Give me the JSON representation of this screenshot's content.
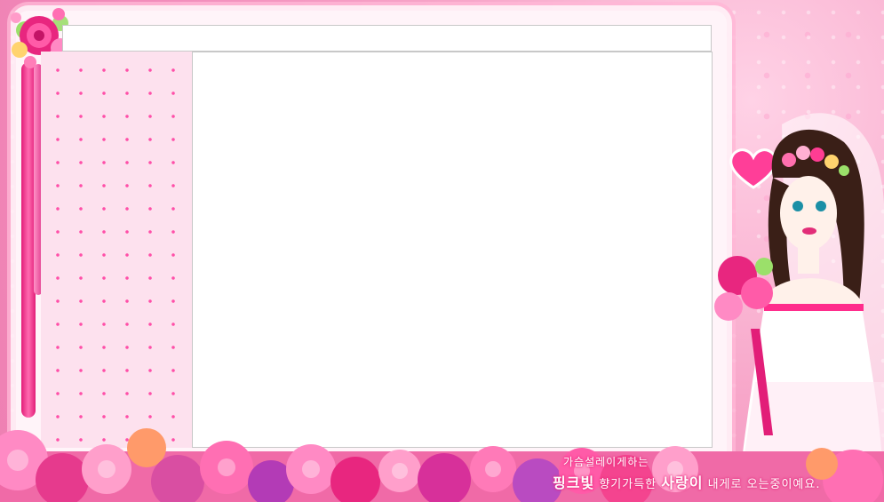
{
  "theme": {
    "accent": "#e21e78",
    "panel_background": "#fde1ee",
    "content_background": "#ffffff",
    "frame_border": "#c8c8c8"
  },
  "top_bar": {
    "text": ""
  },
  "main_content": {
    "text": ""
  },
  "decorations": {
    "corner_icon": "rose-bouquet-icon",
    "heart_icon": "heart-icon",
    "bride_illustration": "bride-illustration",
    "bottom_border": "rose-border"
  },
  "caption": {
    "line1": "가슴설레이게하는",
    "line2_part1": "핑크빛",
    "line2_part2": "향기가득한",
    "line2_part3": "사랑이",
    "line2_part4": "내게로 오는중이예요."
  }
}
